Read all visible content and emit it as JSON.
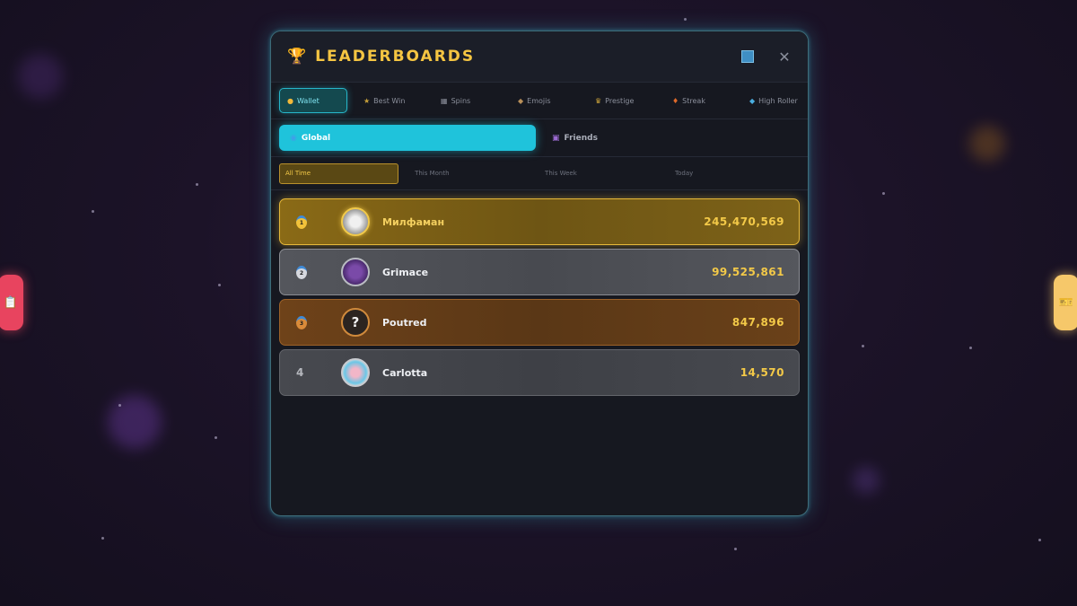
{
  "header": {
    "title": "LEADERBOARDS",
    "trophy_icon": "🏆",
    "close_icon": "✕"
  },
  "categories": [
    {
      "label": "Wallet",
      "icon": "●",
      "icon_color": "#f2b93a",
      "active": true
    },
    {
      "label": "Best Win",
      "icon": "★",
      "icon_color": "#c9a13a"
    },
    {
      "label": "Spins",
      "icon": "▦",
      "icon_color": "#8b8f9b"
    },
    {
      "label": "Emojis",
      "icon": "◆",
      "icon_color": "#b9905a"
    },
    {
      "label": "Prestige",
      "icon": "♛",
      "icon_color": "#c9a13a"
    },
    {
      "label": "Streak",
      "icon": "♦",
      "icon_color": "#e06a2a"
    },
    {
      "label": "High Roller",
      "icon": "◆",
      "icon_color": "#4aaee0"
    }
  ],
  "scopes": [
    {
      "label": "Global",
      "icon": "◉",
      "icon_color": "#3fa0e8",
      "active": true
    },
    {
      "label": "Friends",
      "icon": "▣",
      "icon_color": "#9a6ad0"
    }
  ],
  "periods": [
    {
      "label": "All Time",
      "active": true
    },
    {
      "label": "This Month"
    },
    {
      "label": "This Week"
    },
    {
      "label": "Today"
    }
  ],
  "entries": [
    {
      "rank": "1",
      "name": "Милфаман",
      "score": "245,470,569",
      "tier": "gold"
    },
    {
      "rank": "2",
      "name": "Grimace",
      "score": "99,525,861",
      "tier": "silver"
    },
    {
      "rank": "3",
      "name": "Poutred",
      "score": "847,896",
      "tier": "bronze",
      "avatar_text": "?"
    },
    {
      "rank": "4",
      "name": "Carlotta",
      "score": "14,570",
      "tier": "plain"
    }
  ],
  "side": {
    "left_icon": "📋",
    "right_icon": "🎫"
  },
  "colors": {
    "accent": "#1fc3db",
    "gold": "#f3c948",
    "title": "#f5c542"
  }
}
